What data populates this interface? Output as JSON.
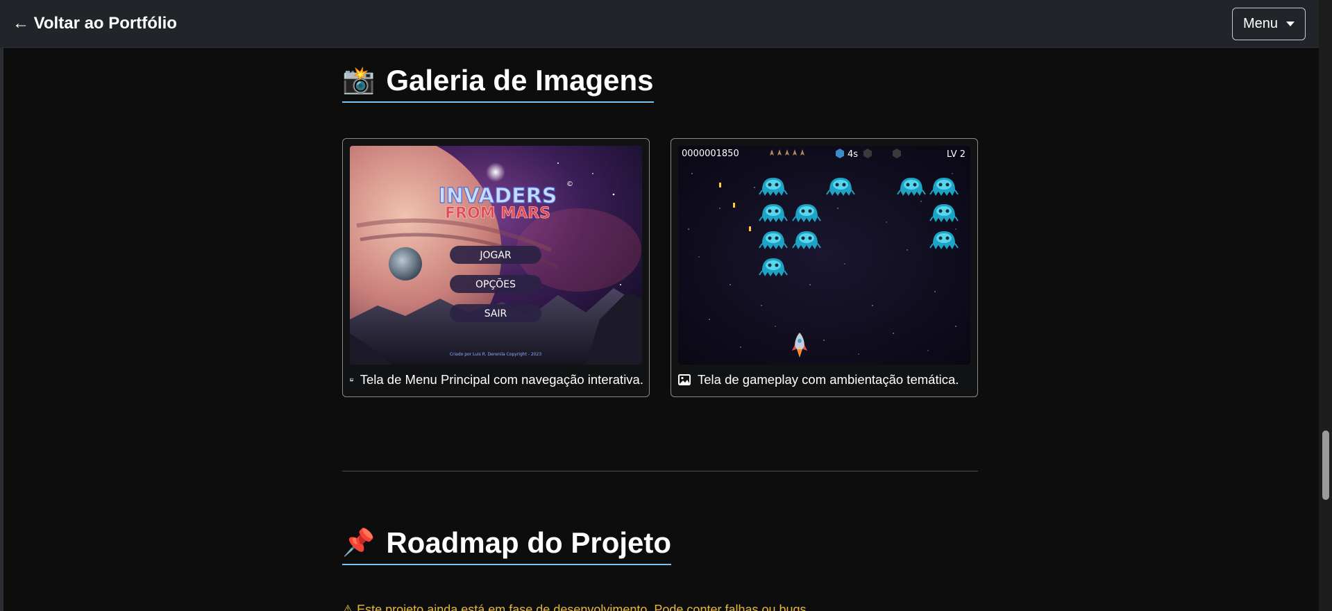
{
  "navbar": {
    "back_link": "← Voltar ao Portfólio",
    "menu_label": "Menu"
  },
  "gallery": {
    "emoji": "📸",
    "title": "Galeria de Imagens",
    "cards": [
      {
        "caption": "Tela de Menu Principal com navegação interativa.",
        "logo_line1": "INVADERS",
        "logo_line2": "FROM MARS",
        "copyright_mark": "©",
        "buttons": [
          "JOGAR",
          "OPÇÕES",
          "SAIR"
        ],
        "credit": "Criado por Luis R. Derenila Copyright - 2023"
      },
      {
        "caption": "Tela de gameplay com ambientação temática.",
        "score": "0000001850",
        "timer": "4s",
        "level": "LV 2"
      }
    ]
  },
  "roadmap": {
    "emoji": "📌",
    "title": "Roadmap do Projeto",
    "notice": "⚠ Este projeto ainda está em fase de desenvolvimento. Pode conter falhas ou bugs."
  },
  "colors": {
    "background": "#0d0d0d",
    "navbar": "#212529",
    "title_underline": "#7dc4f5",
    "warning": "#e6b93a"
  }
}
